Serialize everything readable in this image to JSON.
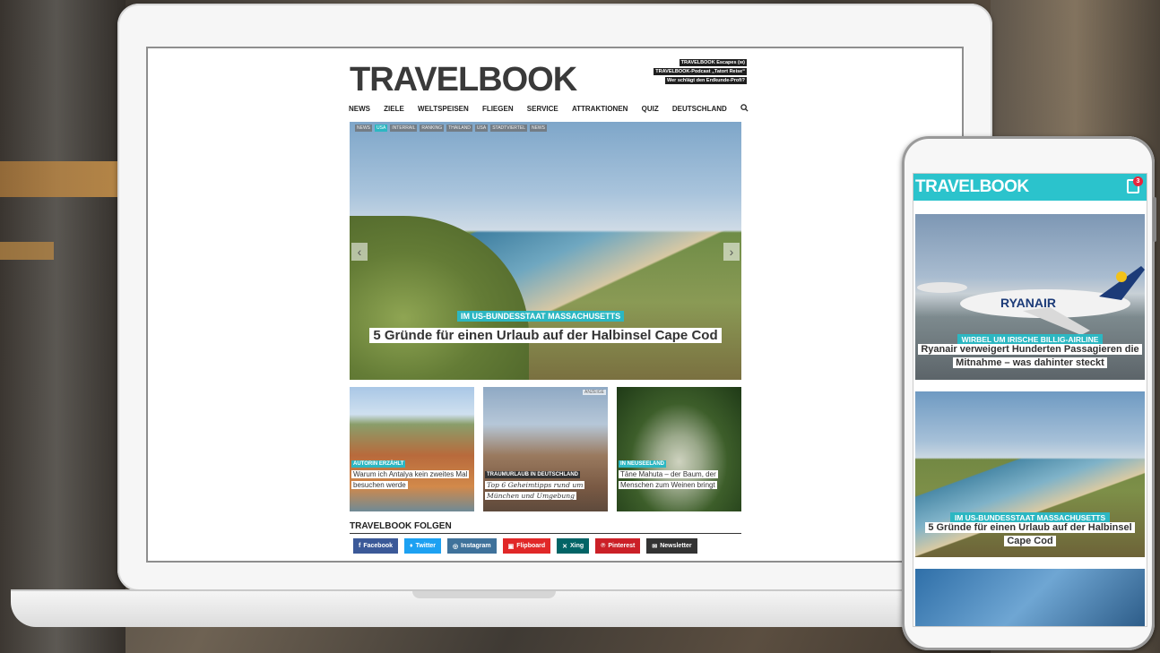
{
  "desktop": {
    "logo": "TRAVELBOOK",
    "header_links": [
      "TRAVELBOOK Escapes (w)",
      "TRAVELBOOK-Podcast „Tatort Reise“",
      "Wer schlägt den Erdkunde-Profi?"
    ],
    "nav": [
      "NEWS",
      "ZIELE",
      "WELTSPEISEN",
      "FLIEGEN",
      "SERVICE",
      "ATTRAKTIONEN",
      "QUIZ",
      "DEUTSCHLAND"
    ],
    "hero": {
      "tags": [
        "NEWS",
        "USA",
        "INTERRAIL",
        "RANKING",
        "THAILAND",
        "USA",
        "STADTVIERTEL",
        "NEWS"
      ],
      "active_tag_index": 1,
      "kicker": "IM US-BUNDESSTAAT MASSACHUSETTS",
      "title": "5 Gründe für einen Urlaub auf der Halbinsel Cape Cod"
    },
    "cards": [
      {
        "kicker": "AUTORIN ERZÄHLT",
        "title": "Warum ich Antalya kein zweites Mal besuchen werde"
      },
      {
        "kicker": "TRAUMURLAUB IN DEUTSCHLAND",
        "title": "Top 6 Geheimtipps rund um München und Umgebung",
        "ad_label": "ANZEIGE"
      },
      {
        "kicker": "IN NEUSEELAND",
        "title": "Tāne Mahuta – der Baum, der Menschen zum Weinen bringt"
      }
    ],
    "follow_heading": "TRAVELBOOK FOLGEN",
    "social": [
      {
        "label": "Facebook",
        "icon": "facebook-icon",
        "color": "#3b5998",
        "glyph": "f"
      },
      {
        "label": "Twitter",
        "icon": "twitter-icon",
        "color": "#1da1f2",
        "glyph": "♦"
      },
      {
        "label": "Instagram",
        "icon": "instagram-icon",
        "color": "#3f729b",
        "glyph": "◎"
      },
      {
        "label": "Flipboard",
        "icon": "flipboard-icon",
        "color": "#e12828",
        "glyph": "▣"
      },
      {
        "label": "Xing",
        "icon": "xing-icon",
        "color": "#026466",
        "glyph": "✕"
      },
      {
        "label": "Pinterest",
        "icon": "pinterest-icon",
        "color": "#cb2027",
        "glyph": "℗"
      },
      {
        "label": "Newsletter",
        "icon": "newsletter-icon",
        "color": "#333333",
        "glyph": "✉"
      }
    ]
  },
  "mobile": {
    "logo": "TRAVELBOOK",
    "tab_count": "3",
    "articles": [
      {
        "kicker": "WIRBEL UM IRISCHE BILLIG-AIRLINE",
        "title": "Ryanair verweigert Hunderten Passagieren die Mitnahme – was dahinter steckt",
        "aircraft_text": "RYANAIR"
      },
      {
        "kicker": "IM US-BUNDESSTAAT MASSACHUSETTS",
        "title": "5 Gründe für einen Urlaub auf der Halbinsel Cape Cod"
      }
    ]
  },
  "colors": {
    "accent": "#2cb7c2",
    "mobile_header": "#2bc3cc"
  }
}
